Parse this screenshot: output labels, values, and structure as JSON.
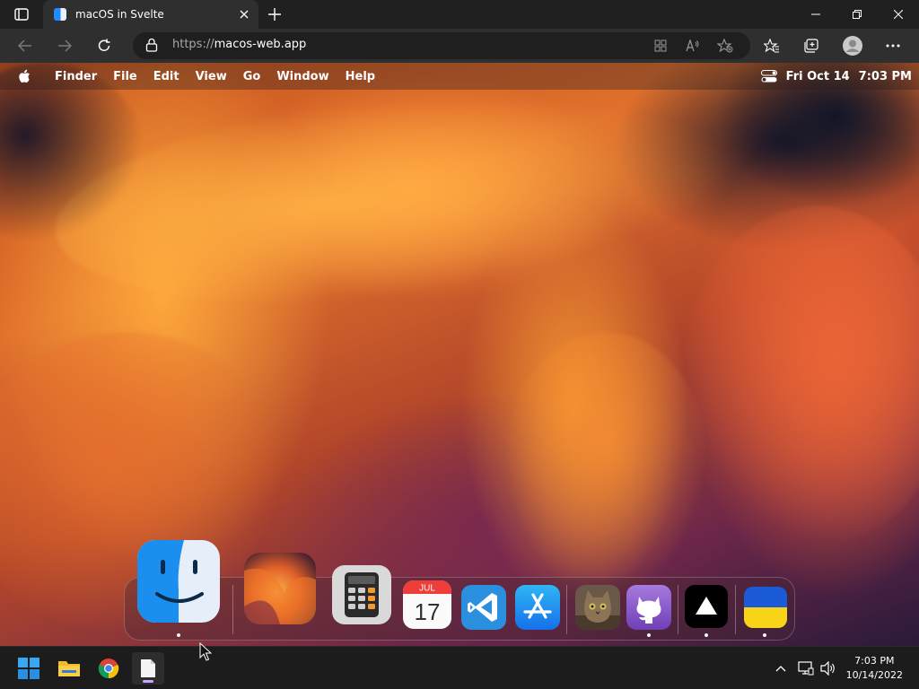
{
  "browser": {
    "tab_title": "macOS in Svelte",
    "url_protocol": "https://",
    "url_host": "macos-web.app"
  },
  "macos": {
    "menubar": {
      "apple": "apple-icon",
      "items": [
        "Finder",
        "File",
        "Edit",
        "View",
        "Go",
        "Window",
        "Help"
      ],
      "date": "Fri Oct 14",
      "time": "7:03 PM"
    },
    "dock": {
      "apps": [
        {
          "name": "Finder",
          "icon": "finder-icon",
          "running": true
        },
        {
          "name": "Wallpapers",
          "icon": "wallpapers-icon",
          "running": false
        },
        {
          "name": "Calculator",
          "icon": "calculator-icon",
          "running": false
        },
        {
          "name": "Calendar",
          "icon": "calendar-icon",
          "running": false,
          "month": "JUL",
          "day": "17"
        },
        {
          "name": "VS Code",
          "icon": "vscode-icon",
          "running": false
        },
        {
          "name": "App Store",
          "icon": "appstore-icon",
          "running": false
        },
        {
          "name": "Purus Twitter",
          "icon": "cat-photo-icon",
          "running": false
        },
        {
          "name": "GitHub",
          "icon": "github-icon",
          "running": true
        },
        {
          "name": "Vercel",
          "icon": "vercel-icon",
          "running": true
        },
        {
          "name": "Ukraine",
          "icon": "ukraine-flag-icon",
          "running": true
        }
      ]
    }
  },
  "taskbar": {
    "time": "7:03 PM",
    "date": "10/14/2022"
  },
  "colors": {
    "chrome_bg": "#202020",
    "toolbar_bg": "#2f2f2f",
    "taskbar_bg": "#1c1c1c",
    "accent_indicator": "#c7a6ff"
  }
}
